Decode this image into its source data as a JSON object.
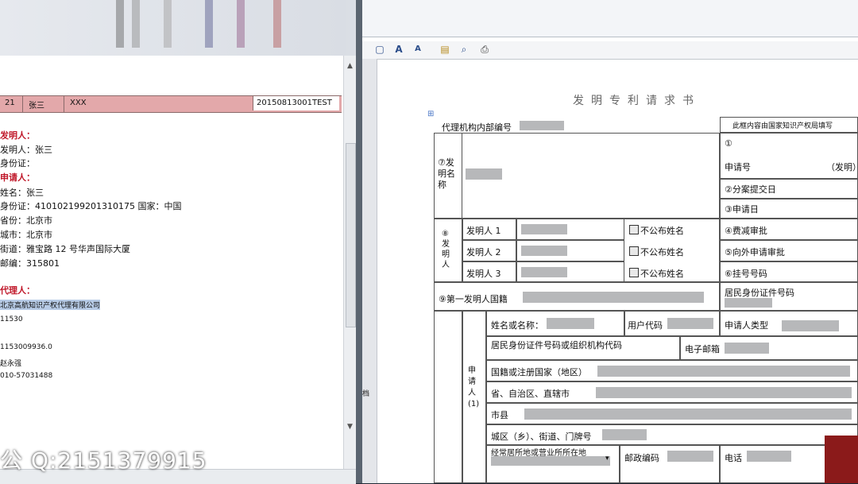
{
  "left_doc": {
    "table_row": {
      "c1": "21",
      "c2": "张三",
      "c3": "XXX",
      "c4": "20150813001TEST"
    },
    "inventor_heading": "发明人：",
    "inventor_name": "发明人：张三",
    "inventor_id": "身份证：",
    "applicant_heading": "申请人：",
    "applicant_name": "姓名：张三",
    "applicant_id": "身份证：410102199201310175 国家：中国",
    "province": "省份：北京市",
    "city": "城市：北京市",
    "street": "街道：雅宝路 12 号华声国际大厦",
    "postcode": "邮编：315801",
    "agent_heading": "代理人：",
    "agent_org": "北京高航知识产权代理有限公司",
    "agent_code": "11530",
    "agent_num": "1153009936.0",
    "agent_person": "赵永强",
    "agent_phone": "010-57031488"
  },
  "form": {
    "title": "发明专利请求书",
    "agency_no_label": "代理机构内部编号",
    "office_header": "此框内容由国家知识产权局填写",
    "invention_name_label": "⑦发明名称",
    "office_fields": [
      "①",
      "申请号",
      "（发明）",
      "②分案提交日",
      "③申请日",
      "④费减审批",
      "⑤向外申请审批",
      "⑥挂号号码"
    ],
    "inventor_section_label": "⑧发明人",
    "inventors": [
      "发明人 1",
      "发明人 2",
      "发明人 3"
    ],
    "hide_name": "不公布姓名",
    "first_inventor_nationality": "⑨第一发明人国籍",
    "citizen_id_label": "居民身份证件号码",
    "applicant_section_label": "申请人(1)",
    "name_label": "姓名或名称：",
    "user_code_label": "用户代码",
    "applicant_type_label": "申请人类型",
    "org_id_label": "居民身份证件号码或组织机构代码",
    "email_label": "电子邮箱",
    "country_label": "国籍或注册国家（地区）",
    "province_label": "省、自治区、直辖市",
    "city_label": "市县",
    "district_label": "城区（乡）、街道、门牌号",
    "business_addr_label": "经常居所地或营业所所在地",
    "postal_label": "邮政编码",
    "phone_label": "电话",
    "side_label": "档"
  },
  "watermark": "Q:2151379915",
  "watermark_prefix": "公",
  "colors": {
    "pink_row": "#e3a8aa",
    "heading_red": "#c0182a",
    "highlight": "#b7cbe6"
  }
}
